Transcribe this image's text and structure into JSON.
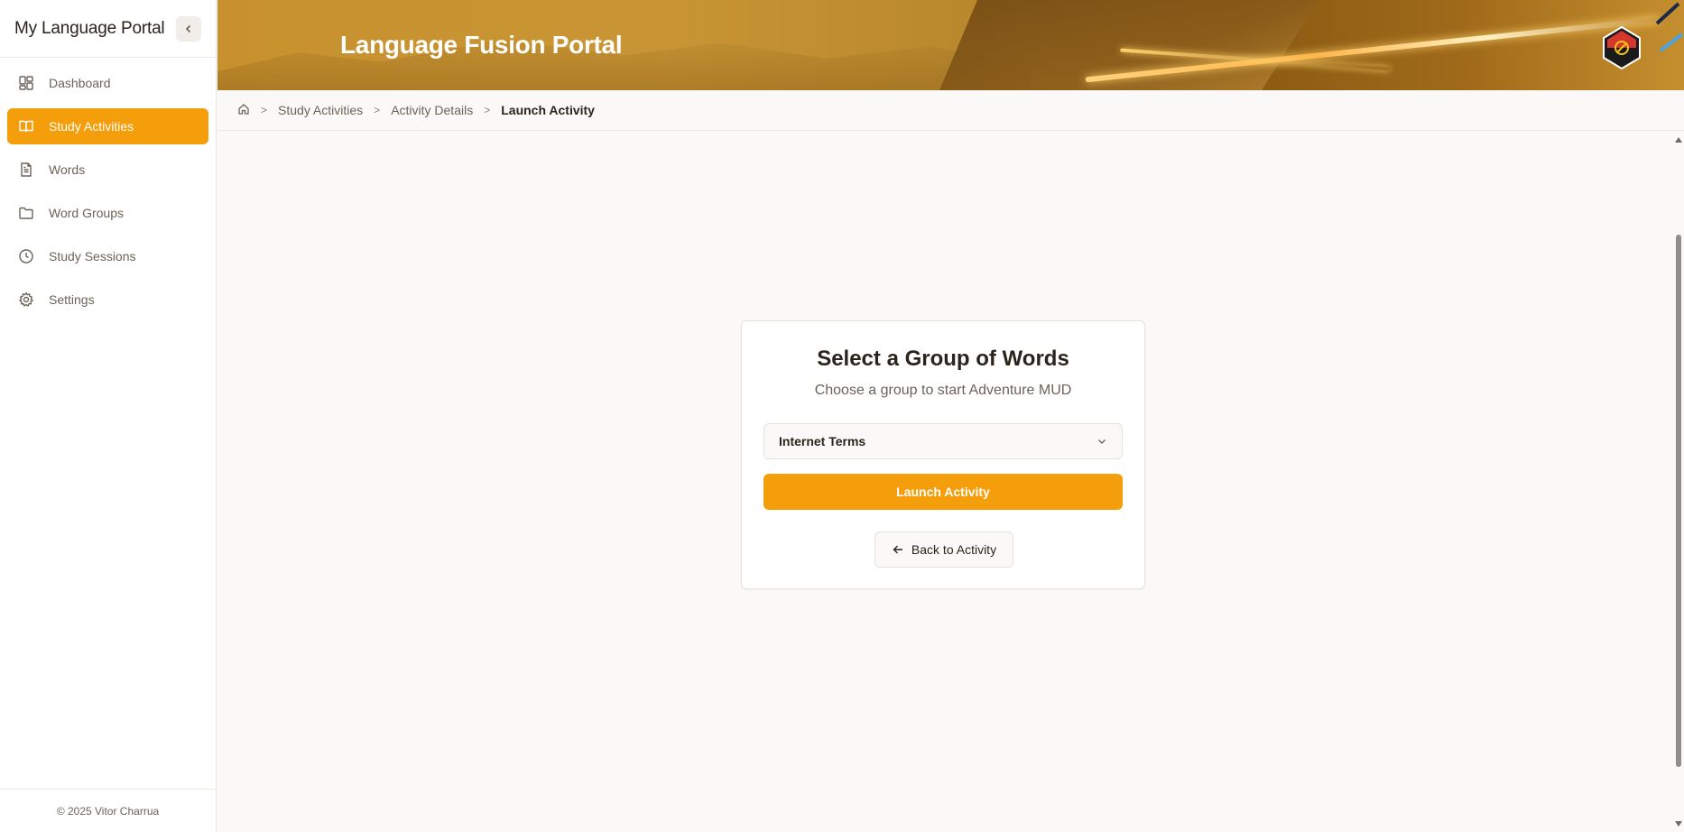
{
  "sidebar": {
    "title": "My Language Portal",
    "collapse_icon": "chevron-left-icon",
    "items": [
      {
        "label": "Dashboard",
        "icon": "dashboard-icon",
        "active": false
      },
      {
        "label": "Study Activities",
        "icon": "book-open-icon",
        "active": true
      },
      {
        "label": "Words",
        "icon": "file-text-icon",
        "active": false
      },
      {
        "label": "Word Groups",
        "icon": "folder-icon",
        "active": false
      },
      {
        "label": "Study Sessions",
        "icon": "clock-icon",
        "active": false
      },
      {
        "label": "Settings",
        "icon": "gear-icon",
        "active": false
      }
    ],
    "footer": "© 2025 Vitor Charrua"
  },
  "header": {
    "title": "Language Fusion Portal"
  },
  "breadcrumb": {
    "items": [
      "Study Activities",
      "Activity Details"
    ],
    "current": "Launch Activity"
  },
  "card": {
    "title": "Select a Group of Words",
    "subtitle": "Choose a group to start Adventure MUD",
    "select_value": "Internet Terms",
    "launch_label": "Launch Activity",
    "back_label": "Back to Activity"
  },
  "colors": {
    "accent": "#f59e0b",
    "text": "#2a241c",
    "muted": "#6b6358"
  }
}
